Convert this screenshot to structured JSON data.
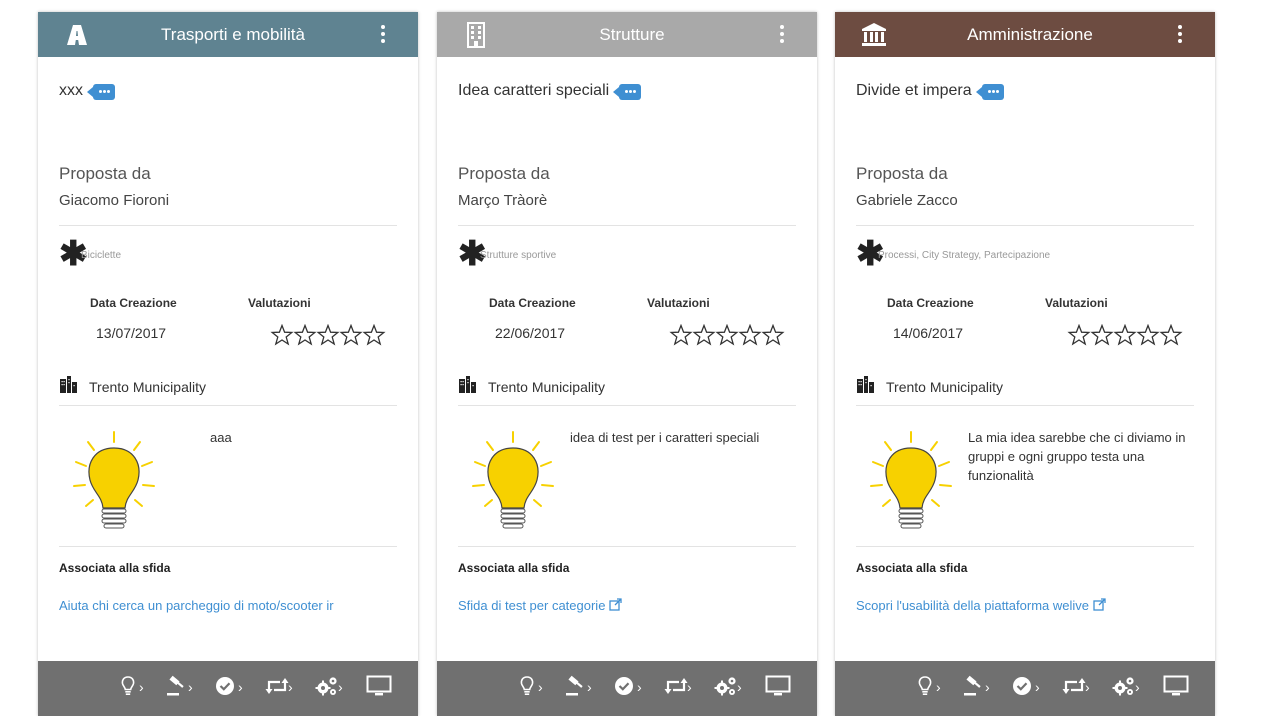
{
  "cards": [
    {
      "header": {
        "category": "Trasporti e mobilità",
        "icon": "road-icon",
        "color": "#5f8391"
      },
      "title": "xxx",
      "proposed_label": "Proposta da",
      "proposed_by": "Giacomo Fioroni",
      "tags": "Biciclette",
      "date_label": "Data Creazione",
      "date": "13/07/2017",
      "ratings_label": "Valutazioni",
      "rating": 0,
      "max_rating": 5,
      "organization": "Trento Municipality",
      "description": "aaa",
      "challenge_label": "Associata alla sfida",
      "challenge": "Aiuta chi cerca un parcheggio di moto/scooter ir"
    },
    {
      "header": {
        "category": "Strutture",
        "icon": "building-icon",
        "color": "#a9a9a9"
      },
      "title": "Idea caratteri speciali",
      "proposed_label": "Proposta da",
      "proposed_by": "Março Tràorè",
      "tags": "Strutture sportive",
      "date_label": "Data Creazione",
      "date": "22/06/2017",
      "ratings_label": "Valutazioni",
      "rating": 0,
      "max_rating": 5,
      "organization": "Trento Municipality",
      "description": "idea di test per i caratteri speciali",
      "challenge_label": "Associata alla sfida",
      "challenge": "Sfida di test per categorie"
    },
    {
      "header": {
        "category": "Amministrazione",
        "icon": "institution-icon",
        "color": "#6d4c41"
      },
      "title": "Divide et impera",
      "proposed_label": "Proposta da",
      "proposed_by": "Gabriele Zacco",
      "tags": "Processi, City Strategy, Partecipazione",
      "date_label": "Data Creazione",
      "date": "14/06/2017",
      "ratings_label": "Valutazioni",
      "rating": 0,
      "max_rating": 5,
      "organization": "Trento Municipality",
      "description": "La mia idea sarebbe che ci diviamo in gruppi e ogni gruppo testa una funzionalità",
      "challenge_label": "Associata alla sfida",
      "challenge": "Scopri l'usabilità della piattaforma welive"
    }
  ],
  "colors": {
    "link": "#3f8fd2",
    "tag_badge": "#3f8fd2",
    "footer": "#707070",
    "bulb": "#f7d100"
  },
  "footer_steps": [
    "lightbulb-icon",
    "gavel-icon",
    "check-circle-icon",
    "retweet-icon",
    "cogs-icon",
    "monitor-icon"
  ]
}
